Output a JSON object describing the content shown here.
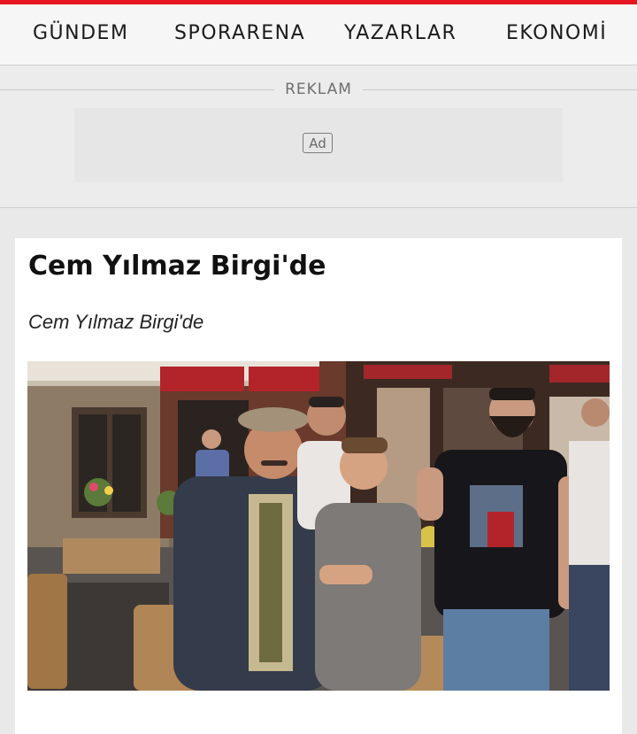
{
  "nav": {
    "items": [
      {
        "label": "GÜNDEM"
      },
      {
        "label": "SPORARENA"
      },
      {
        "label": "YAZARLAR"
      },
      {
        "label": "EKONOMİ"
      }
    ]
  },
  "ad": {
    "label": "REKLAM",
    "badge": "Ad"
  },
  "article": {
    "title": "Cem Yılmaz Birgi'de",
    "subtitle": "Cem Yılmaz Birgi'de"
  },
  "colors": {
    "accent": "#e3161f",
    "nav_bg": "#f6f6f6",
    "page_bg": "#e9e9e9"
  }
}
